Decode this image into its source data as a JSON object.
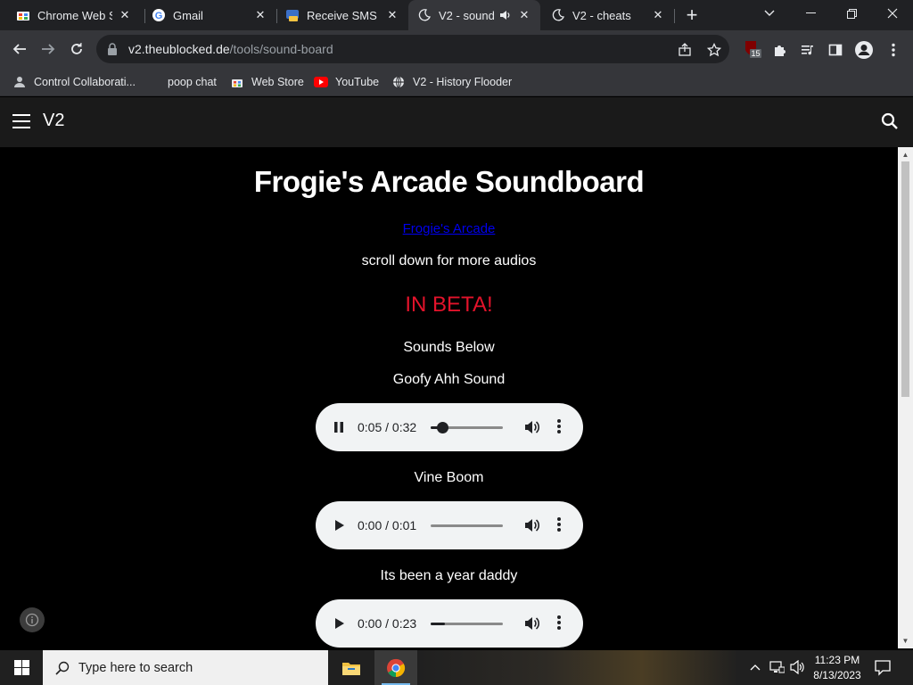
{
  "browser": {
    "tabs": [
      {
        "title": "Chrome Web Store",
        "favicon": "chrome-web-store-icon"
      },
      {
        "title": "Gmail",
        "favicon": "google-icon"
      },
      {
        "title": "Receive SMS online",
        "favicon": "sms-site-icon"
      },
      {
        "title": "V2 - sound",
        "favicon": "moon-icon",
        "audio": "speaker-icon"
      },
      {
        "title": "V2 - cheats",
        "favicon": "moon-icon"
      }
    ],
    "url_host": "v2.theublocked.de",
    "url_path": "/tools/sound-board",
    "extension_badge": "15",
    "bookmarks": [
      {
        "label": "Control Collaborati..."
      },
      {
        "label": "poop chat"
      },
      {
        "label": "Web Store"
      },
      {
        "label": "YouTube"
      },
      {
        "label": "V2 - History Flooder"
      }
    ]
  },
  "site": {
    "logo": "V2"
  },
  "page": {
    "title": "Frogie's Arcade Soundboard",
    "link_text": "Frogie's Arcade",
    "scroll_note": "scroll down for more audios",
    "beta": "IN BETA!",
    "sounds_heading": "Sounds Below",
    "sounds": [
      {
        "label": "Goofy Ahh Sound",
        "time": "0:05 / 0:32",
        "playing": true,
        "progress": 0.156
      },
      {
        "label": "Vine Boom",
        "time": "0:00 / 0:01",
        "playing": false,
        "progress": 0.0
      },
      {
        "label": "Its been a year daddy",
        "time": "0:00 / 0:23",
        "playing": false,
        "progress": 0.0
      }
    ]
  },
  "taskbar": {
    "search_placeholder": "Type here to search",
    "time": "11:23 PM",
    "date": "8/13/2023"
  },
  "colors": {
    "beta": "#e3132b",
    "link": "#0000ee",
    "chrome_dark": "#35363a"
  }
}
